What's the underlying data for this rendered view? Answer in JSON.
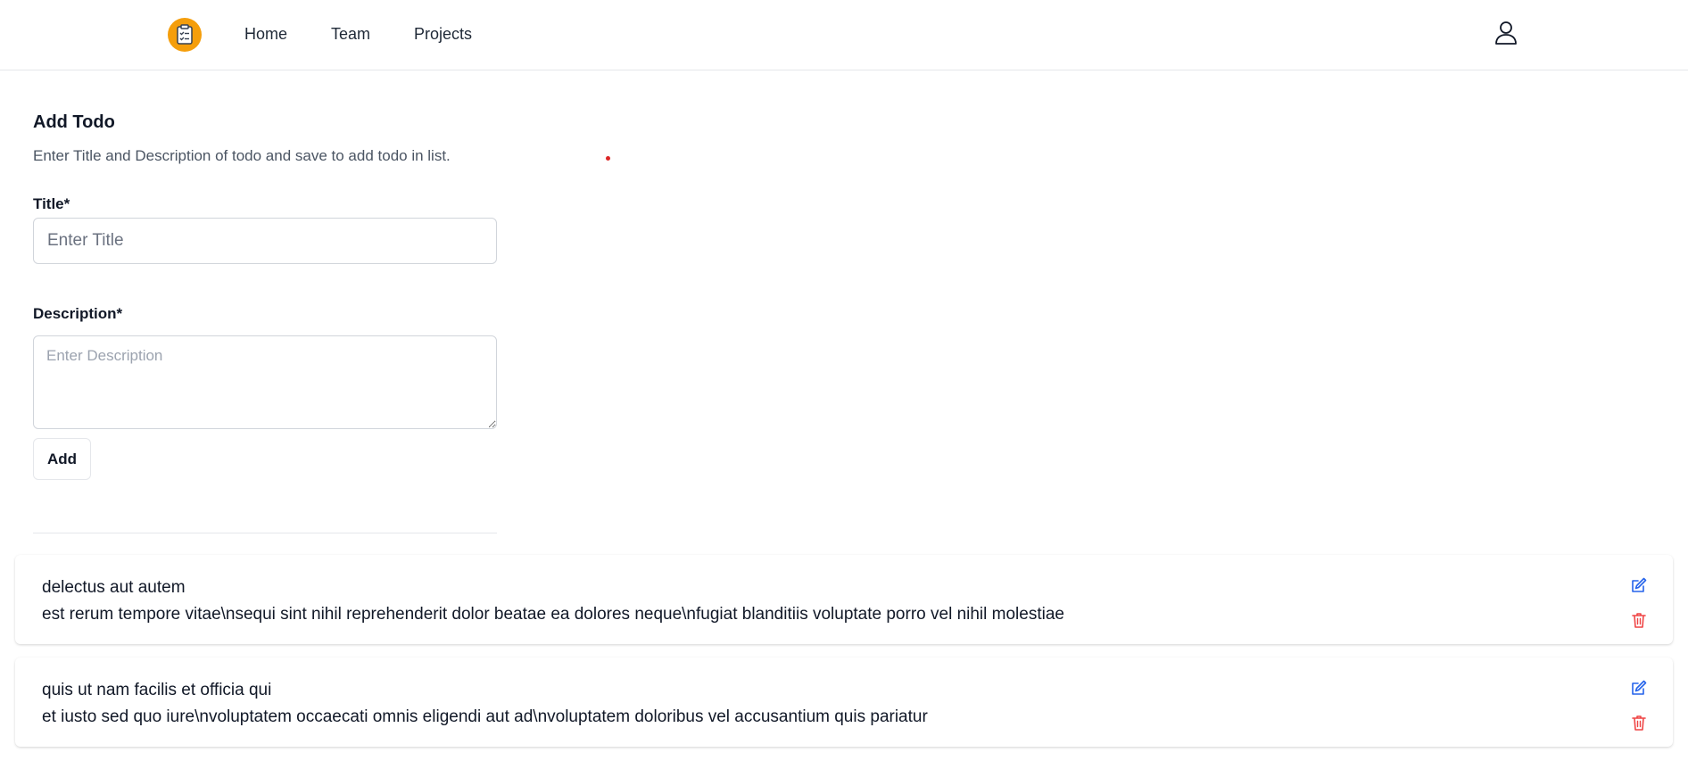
{
  "navbar": {
    "logo_icon": "clipboard-checklist-icon",
    "links": [
      {
        "label": "Home"
      },
      {
        "label": "Team"
      },
      {
        "label": "Projects"
      }
    ],
    "user_icon": "user-icon"
  },
  "form": {
    "title": "Add Todo",
    "description": "Enter Title and Description of todo and save to add todo in list.",
    "title_label": "Title*",
    "title_placeholder": "Enter Title",
    "title_value": "",
    "description_label": "Description*",
    "description_placeholder": "Enter Description",
    "description_value": "",
    "add_label": "Add"
  },
  "todos": [
    {
      "title": "delectus aut autem",
      "description": "est rerum tempore vitae\\nsequi sint nihil reprehenderit dolor beatae ea dolores neque\\nfugiat blanditiis voluptate porro vel nihil molestiae"
    },
    {
      "title": "quis ut nam facilis et officia qui",
      "description": "et iusto sed quo iure\\nvoluptatem occaecati omnis eligendi aut ad\\nvoluptatem doloribus vel accusantium quis pariatur"
    }
  ],
  "colors": {
    "logo_bg": "#f59e0b",
    "edit_icon": "#2563eb",
    "delete_icon": "#ef4444",
    "marker_dot": "#dc2626"
  }
}
